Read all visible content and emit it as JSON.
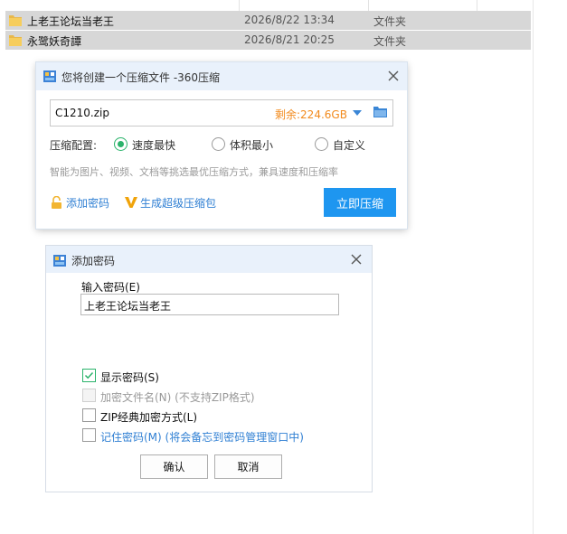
{
  "explorer": {
    "files": [
      {
        "name": "上老王论坛当老王",
        "date": "2026/8/22 13:34",
        "type": "文件夹"
      },
      {
        "name": "永鹭妖奇譚",
        "date": "2026/8/21 20:25",
        "type": "文件夹"
      }
    ]
  },
  "compress_dialog": {
    "title": "您将创建一个压缩文件 -360压缩",
    "filename": "C1210.zip",
    "free_space": "剩余:224.6GB",
    "config_label": "压缩配置:",
    "options": [
      {
        "label": "速度最快",
        "selected": true
      },
      {
        "label": "体积最小",
        "selected": false
      },
      {
        "label": "自定义",
        "selected": false
      }
    ],
    "hint": "智能为图片、视频、文档等挑选最优压缩方式，兼具速度和压缩率",
    "add_password_link": "添加密码",
    "super_package_link": "生成超级压缩包",
    "compress_button": "立即压缩"
  },
  "password_dialog": {
    "title": "添加密码",
    "input_label": "输入密码(E)",
    "input_value": "上老王论坛当老王",
    "checkboxes": [
      {
        "label": "显示密码(S)",
        "checked": true,
        "disabled": false
      },
      {
        "label": "加密文件名(N) (不支持ZIP格式)",
        "checked": false,
        "disabled": true
      },
      {
        "label": "ZIP经典加密方式(L)",
        "checked": false,
        "disabled": false
      },
      {
        "label": "记住密码(M) (将会备忘到密码管理窗口中)",
        "checked": false,
        "disabled": false
      }
    ],
    "ok_button": "确认",
    "cancel_button": "取消"
  },
  "colors": {
    "accent_blue": "#1e96f0",
    "link_blue": "#2f7fd3",
    "free_space_orange": "#f28a1c",
    "check_green": "#2bb36b",
    "titlebar_bg": "#e9f1fb",
    "selected_row_bg": "#d7d7d7"
  }
}
